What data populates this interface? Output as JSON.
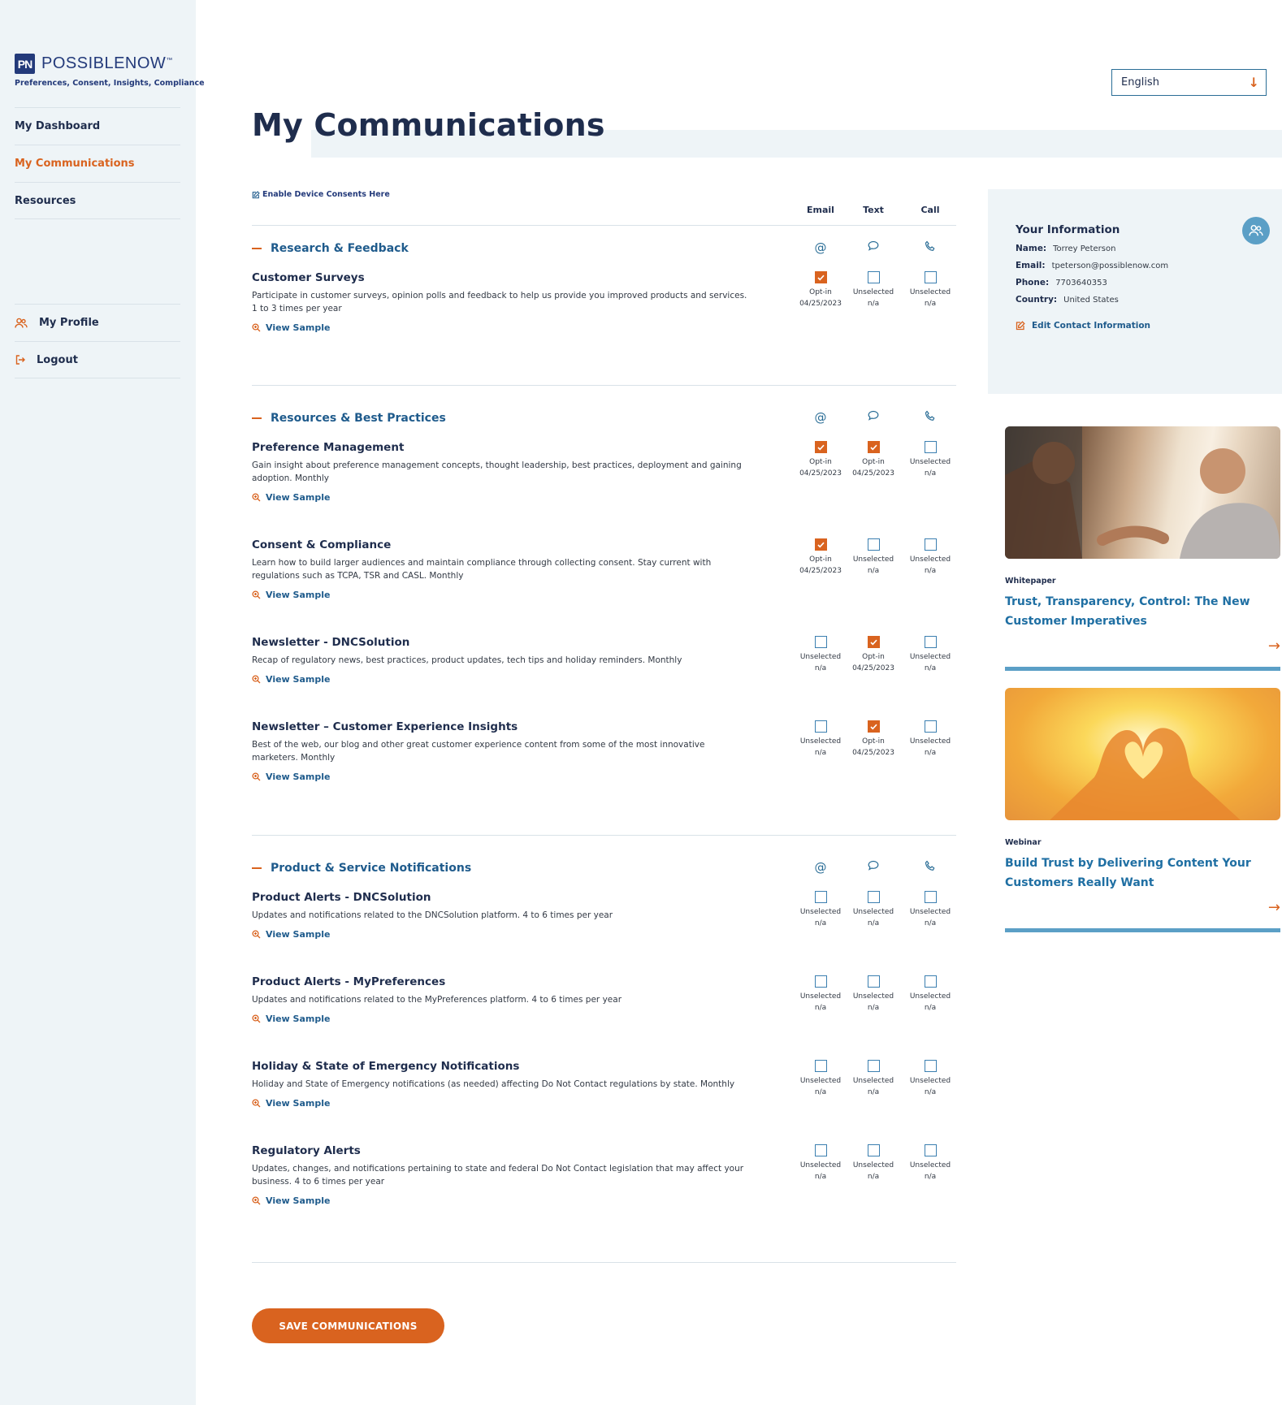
{
  "brand": {
    "logo_mark": "PN",
    "name": "POSSIBLENOW",
    "tm": "™",
    "tagline": "Preferences, Consent, Insights, Compliance"
  },
  "sidebar": {
    "nav": [
      "My Dashboard",
      "My Communications",
      "Resources"
    ],
    "active": "My Communications",
    "bottom": [
      {
        "label": "My Profile",
        "icon": "users-icon"
      },
      {
        "label": "Logout",
        "icon": "logout-icon"
      }
    ]
  },
  "language": {
    "selected": "English",
    "icon": "arrow-down-icon"
  },
  "page": {
    "title": "My Communications"
  },
  "consents": {
    "enable_link": "Enable Device Consents Here",
    "columns": [
      "Email",
      "Text",
      "Call"
    ],
    "channel_icons": [
      "at-icon",
      "chat-bubble-icon",
      "phone-icon"
    ],
    "view_sample": "View Sample",
    "sections": [
      {
        "title": "Research & Feedback",
        "items": [
          {
            "name": "Customer Surveys",
            "desc": "Participate in customer surveys, opinion polls and feedback to help us provide you improved products and services. 1 to 3 times per year",
            "states": [
              {
                "on": true,
                "status": "Opt-in",
                "date": "04/25/2023"
              },
              {
                "on": false,
                "status": "Unselected",
                "date": "n/a"
              },
              {
                "on": false,
                "status": "Unselected",
                "date": "n/a"
              }
            ]
          }
        ]
      },
      {
        "title": "Resources & Best Practices",
        "items": [
          {
            "name": "Preference Management",
            "desc": "Gain insight about preference management concepts, thought leadership, best practices, deployment and gaining adoption. Monthly",
            "states": [
              {
                "on": true,
                "status": "Opt-in",
                "date": "04/25/2023"
              },
              {
                "on": true,
                "status": "Opt-in",
                "date": "04/25/2023"
              },
              {
                "on": false,
                "status": "Unselected",
                "date": "n/a"
              }
            ]
          },
          {
            "name": "Consent & Compliance",
            "desc": "Learn how to build larger audiences and maintain compliance through collecting consent. Stay current with regulations such as TCPA, TSR and CASL. Monthly",
            "states": [
              {
                "on": true,
                "status": "Opt-in",
                "date": "04/25/2023"
              },
              {
                "on": false,
                "status": "Unselected",
                "date": "n/a"
              },
              {
                "on": false,
                "status": "Unselected",
                "date": "n/a"
              }
            ]
          },
          {
            "name": "Newsletter - DNCSolution",
            "desc": "Recap of regulatory news, best practices, product updates, tech tips and holiday reminders. Monthly",
            "states": [
              {
                "on": false,
                "status": "Unselected",
                "date": "n/a"
              },
              {
                "on": true,
                "status": "Opt-in",
                "date": "04/25/2023"
              },
              {
                "on": false,
                "status": "Unselected",
                "date": "n/a"
              }
            ]
          },
          {
            "name": "Newsletter – Customer Experience Insights",
            "desc": "Best of the web, our blog and other great customer experience content from some of the most innovative marketers. Monthly",
            "states": [
              {
                "on": false,
                "status": "Unselected",
                "date": "n/a"
              },
              {
                "on": true,
                "status": "Opt-in",
                "date": "04/25/2023"
              },
              {
                "on": false,
                "status": "Unselected",
                "date": "n/a"
              }
            ]
          }
        ]
      },
      {
        "title": "Product & Service Notifications",
        "items": [
          {
            "name": "Product Alerts - DNCSolution",
            "desc": "Updates and notifications related to the DNCSolution platform. 4 to 6 times per year",
            "states": [
              {
                "on": false,
                "status": "Unselected",
                "date": "n/a"
              },
              {
                "on": false,
                "status": "Unselected",
                "date": "n/a"
              },
              {
                "on": false,
                "status": "Unselected",
                "date": "n/a"
              }
            ]
          },
          {
            "name": "Product Alerts - MyPreferences",
            "desc": "Updates and notifications related to the MyPreferences platform. 4 to 6 times per year",
            "states": [
              {
                "on": false,
                "status": "Unselected",
                "date": "n/a"
              },
              {
                "on": false,
                "status": "Unselected",
                "date": "n/a"
              },
              {
                "on": false,
                "status": "Unselected",
                "date": "n/a"
              }
            ]
          },
          {
            "name": "Holiday & State of Emergency Notifications",
            "desc": "Holiday and State of Emergency notifications (as needed) affecting Do Not Contact regulations by state. Monthly",
            "states": [
              {
                "on": false,
                "status": "Unselected",
                "date": "n/a"
              },
              {
                "on": false,
                "status": "Unselected",
                "date": "n/a"
              },
              {
                "on": false,
                "status": "Unselected",
                "date": "n/a"
              }
            ]
          },
          {
            "name": "Regulatory Alerts",
            "desc": "Updates, changes, and notifications pertaining to state and federal Do Not Contact legislation that may affect your business. 4 to 6 times per year",
            "states": [
              {
                "on": false,
                "status": "Unselected",
                "date": "n/a"
              },
              {
                "on": false,
                "status": "Unselected",
                "date": "n/a"
              },
              {
                "on": false,
                "status": "Unselected",
                "date": "n/a"
              }
            ]
          }
        ]
      }
    ],
    "save_label": "SAVE COMMUNICATIONS"
  },
  "info": {
    "title": "Your Information",
    "name_label": "Name:",
    "name": "Torrey Peterson",
    "email_label": "Email:",
    "email": "tpeterson@possiblenow.com",
    "phone_label": "Phone:",
    "phone": "7703640353",
    "country_label": "Country:",
    "country": "United States",
    "edit_label": "Edit Contact Information"
  },
  "cards": [
    {
      "type": "Whitepaper",
      "title": "Trust, Transparency, Control: The New Customer Imperatives"
    },
    {
      "type": "Webinar",
      "title": "Build Trust by Delivering Content Your Customers Really Want"
    }
  ],
  "colors": {
    "accent": "#d9631f",
    "navy": "#1f2d4d",
    "link": "#1f5b8c",
    "panel": "#eef4f7"
  }
}
